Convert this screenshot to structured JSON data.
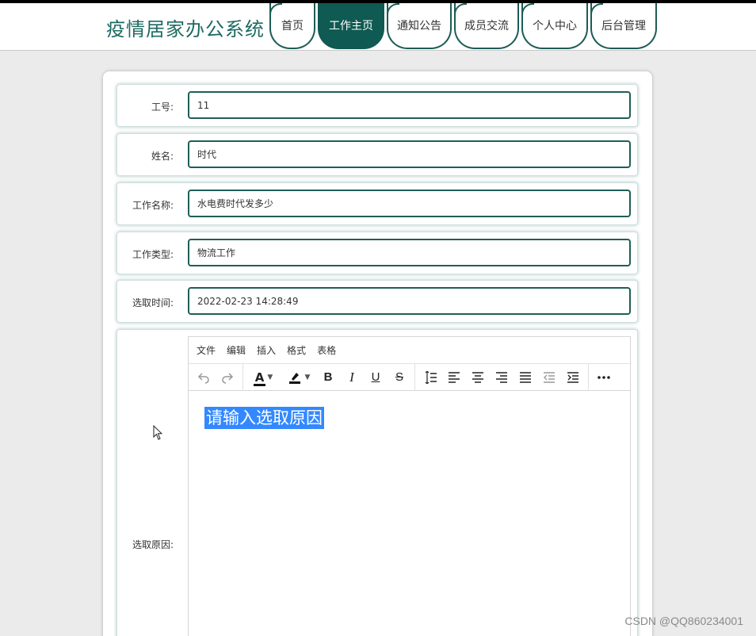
{
  "site": {
    "title": "疫情居家办公系统"
  },
  "nav": {
    "tabs": [
      {
        "label": "首页",
        "active": false
      },
      {
        "label": "工作主页",
        "active": true
      },
      {
        "label": "通知公告",
        "active": false
      },
      {
        "label": "成员交流",
        "active": false
      },
      {
        "label": "个人中心",
        "active": false
      },
      {
        "label": "后台管理",
        "active": false
      }
    ]
  },
  "form": {
    "job_id": {
      "label": "工号:",
      "value": "11"
    },
    "name": {
      "label": "姓名:",
      "value": "时代"
    },
    "job_name": {
      "label": "工作名称:",
      "value": "水电费时代发多少"
    },
    "job_type": {
      "label": "工作类型:",
      "value": "物流工作"
    },
    "select_time": {
      "label": "选取时间:",
      "value": "2022-02-23 14:28:49"
    },
    "reason": {
      "label": "选取原因:",
      "placeholder": "请输入选取原因"
    }
  },
  "editor": {
    "menu": [
      "文件",
      "编辑",
      "插入",
      "格式",
      "表格"
    ],
    "toolbar_icons": [
      "undo-icon",
      "redo-icon",
      "text-color-icon",
      "highlight-icon",
      "bold-icon",
      "italic-icon",
      "underline-icon",
      "strikethrough-icon",
      "line-height-icon",
      "align-left-icon",
      "align-center-icon",
      "align-right-icon",
      "justify-icon",
      "outdent-icon",
      "indent-icon",
      "more-icon"
    ]
  },
  "watermark": "CSDN @QQ860234001",
  "colors": {
    "primary": "#0f5a52",
    "title": "#1e6a62",
    "selection": "#3388ff"
  }
}
